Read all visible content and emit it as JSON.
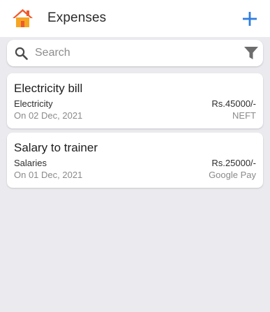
{
  "header": {
    "title": "Expenses",
    "home_icon": "home-icon",
    "add_icon": "plus-icon"
  },
  "search": {
    "placeholder": "Search",
    "value": "",
    "filter_icon": "filter-icon"
  },
  "expenses": [
    {
      "title": "Electricity bill",
      "category": "Electricity",
      "date": "On 02 Dec, 2021",
      "amount": "Rs.45000/-",
      "method": "NEFT"
    },
    {
      "title": "Salary to trainer",
      "category": "Salaries",
      "date": "On 01 Dec, 2021",
      "amount": "Rs.25000/-",
      "method": "Google Pay"
    }
  ],
  "colors": {
    "accent": "#2f7de1",
    "home_roof": "#f0592b",
    "home_wall": "#f5a623",
    "background": "#ebebef"
  }
}
